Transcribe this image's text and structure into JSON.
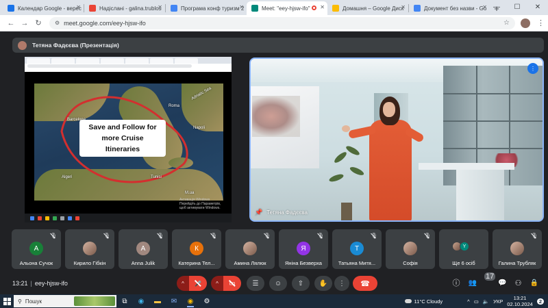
{
  "browser": {
    "tabs": [
      {
        "label": "Календар Google - верес",
        "favicon_color": "#1a73e8"
      },
      {
        "label": "Надіслані - galina.trublos",
        "favicon_color": "#ea4335"
      },
      {
        "label": "Програма конф туризм 2",
        "favicon_color": "#4285f4"
      },
      {
        "label": "Meet: \"eey-hjsw-ifo\"",
        "favicon_color": "#00897b",
        "active": true
      },
      {
        "label": "Домашня – Google Диск",
        "favicon_color": "#fbbc04"
      },
      {
        "label": "Документ без назви - Go",
        "favicon_color": "#4285f4"
      }
    ],
    "new_tab": "+",
    "window": {
      "minimize": "—",
      "maximize": "☐",
      "close": "✕"
    },
    "nav": {
      "back": "←",
      "forward": "→",
      "reload": "↻"
    },
    "url": "meet.google.com/eey-hjsw-ifo",
    "bookmark_star": "☆",
    "menu": "⋮"
  },
  "meet": {
    "presenter_label": "Тетяна Фадєєва (Презентація)",
    "shared_screen": {
      "caption": "Save and Follow for more Cruise Itineraries",
      "map_labels": [
        "Barcelona",
        "Roma",
        "Napoli",
        "Adriatic Sea",
        "Algeri",
        "Tunisi",
        "M.ua"
      ],
      "watermark": "Активація Windows Перейдіть до Параметрів, щоб активувати Windows."
    },
    "main_video": {
      "name": "Тетяна Фадєєва",
      "speaking_icon": "⋮",
      "pin_icon": "📌"
    },
    "participants": [
      {
        "name": "Альона Сучок",
        "initial": "А",
        "color": "#188038"
      },
      {
        "name": "Кирило Гібкін",
        "initial": "",
        "color": "",
        "photo": true
      },
      {
        "name": "Anna Julik",
        "initial": "A",
        "color": "#a1887f"
      },
      {
        "name": "Катерина Тел...",
        "initial": "К",
        "color": "#e8710a"
      },
      {
        "name": "Амина Лялюк",
        "initial": "",
        "color": "",
        "photo": true
      },
      {
        "name": "Яніна Безверха",
        "initial": "Я",
        "color": "#9334e6"
      },
      {
        "name": "Татьяна Митя...",
        "initial": "Т",
        "color": "#1a8bd4"
      },
      {
        "name": "Софія",
        "initial": "",
        "color": "",
        "photo": true
      },
      {
        "name": "Ще 6 осіб",
        "initial": "",
        "color": "",
        "multi": [
          "",
          "Y"
        ]
      },
      {
        "name": "Галина Трубляк",
        "initial": "",
        "color": "",
        "photo": true
      }
    ],
    "controls": {
      "time": "13:21",
      "separator": "|",
      "meeting_code": "eey-hjsw-ifo",
      "caret": "^",
      "mic_icon": "🎤",
      "cam_icon": "▭",
      "captions_icon": "☰",
      "emoji_icon": "☺",
      "present_icon": "⇧",
      "raise_hand_icon": "✋",
      "more_icon": "⋮",
      "hangup_icon": "☎",
      "info_icon": "ⓘ",
      "people_icon": "👥",
      "people_count": "17",
      "chat_icon": "💬",
      "activities_icon": "⚇",
      "host_icon": "🔒"
    }
  },
  "taskbar": {
    "search_placeholder": "Пошук",
    "weather": "11°C  Cloudy",
    "language": "УКР",
    "time": "13:21",
    "date": "02.10.2024",
    "notifications": "2"
  }
}
